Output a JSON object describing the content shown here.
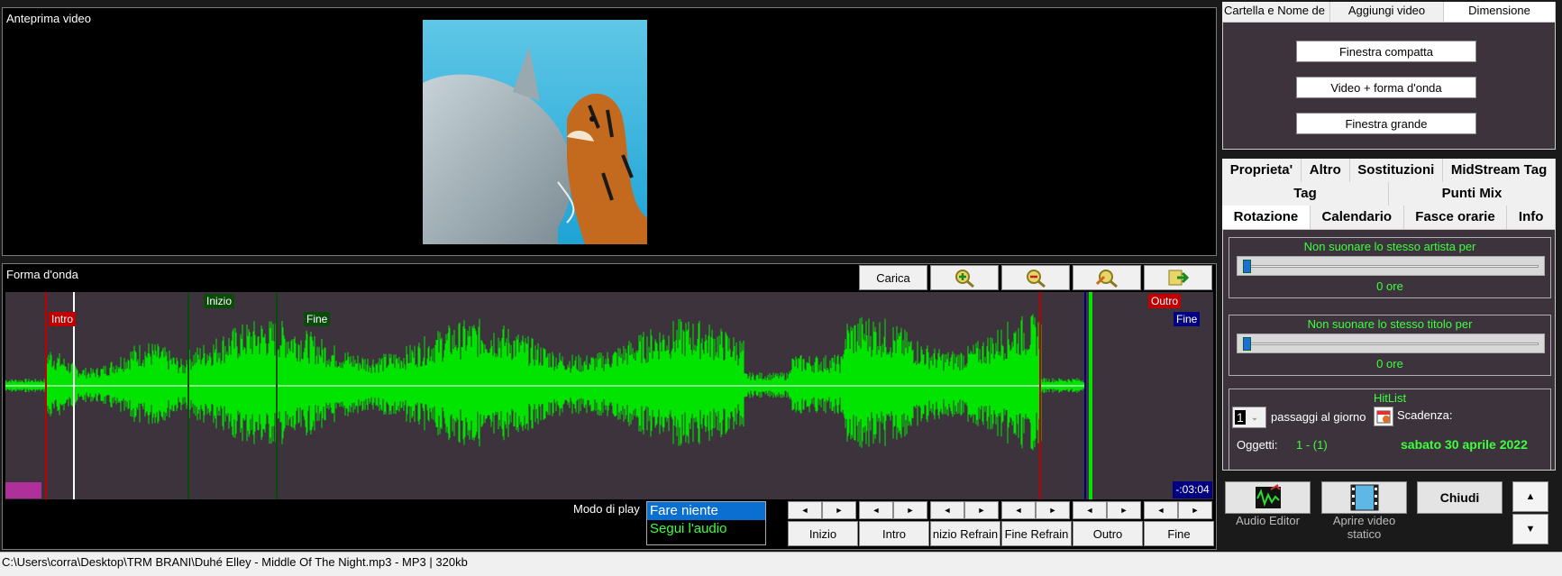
{
  "video": {
    "title": "Anteprima video"
  },
  "waveform": {
    "title": "Forma d'onda",
    "load_label": "Carica",
    "markers": {
      "intro": "Intro",
      "inizio": "Inizio",
      "fine_refrain": "Fine",
      "outro": "Outro",
      "fine": "Fine"
    },
    "time_remaining": "-:03:04",
    "colors": {
      "wave": "#00e400",
      "background": "#3c333c",
      "intro": "#c00000",
      "inizio": "#0a4a0a",
      "outro": "#c00000",
      "fine": "#000080"
    }
  },
  "playmode": {
    "label": "Modo di play",
    "options": [
      "Fare niente",
      "Segui l'audio"
    ],
    "selected": "Fare niente"
  },
  "cue_buttons": [
    "Inizio",
    "Intro",
    "nizio Refrain",
    "Fine Refrain",
    "Outro",
    "Fine"
  ],
  "statusbar": {
    "path": "C:\\Users\\corra\\Desktop\\TRM BRANI\\Duhé Elley - Middle Of The Night.mp3 - MP3 | 320kb"
  },
  "top_tabs": [
    "Cartella e Nome de",
    "Aggiungi video",
    "Dimensione"
  ],
  "top_tabs_active": "Dimensione",
  "dimension_buttons": [
    "Finestra compatta",
    "Video + forma d'onda",
    "Finestra grande"
  ],
  "prop_tabs": {
    "row1": [
      "Proprieta'",
      "Altro",
      "Sostituzioni",
      "MidStream Tag"
    ],
    "row2": [
      "Tag",
      "Punti Mix"
    ],
    "row3": [
      "Rotazione",
      "Calendario",
      "Fasce orarie",
      "Info"
    ],
    "active": "Rotazione"
  },
  "rotation": {
    "artist_title": "Non suonare lo stesso artista per",
    "artist_value": "0 ore",
    "title_title": "Non suonare lo stesso titolo per",
    "title_value": "0 ore",
    "hitlist": {
      "title": "HitList",
      "count": "1",
      "passes_label": "passaggi al giorno",
      "expiry_label": "Scadenza:",
      "objects_label": "Oggetti:",
      "objects_value": "1 - (1)",
      "date": "sabato 30 aprile 2022"
    }
  },
  "actions": {
    "audio_editor": "Audio Editor",
    "open_static_video": "Aprire video statico",
    "close": "Chiudi"
  }
}
